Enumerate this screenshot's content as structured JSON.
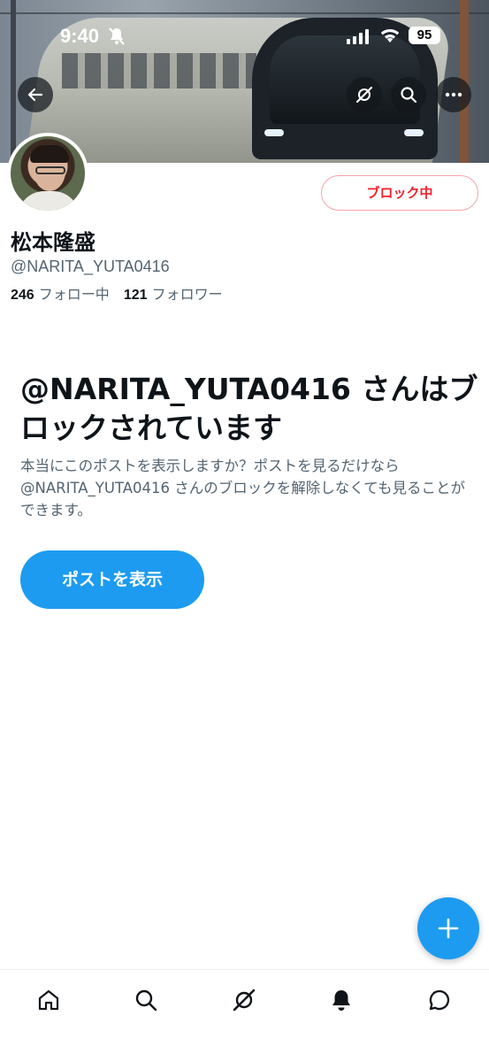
{
  "status_bar": {
    "time": "9:40",
    "battery": "95"
  },
  "profile": {
    "display_name": "松本隆盛",
    "handle": "@NARITA_YUTA0416",
    "following_count": "246",
    "following_label": "フォロー中",
    "followers_count": "121",
    "followers_label": "フォロワー",
    "block_button_label": "ブロック中"
  },
  "blocked_notice": {
    "title": "@NARITA_YUTA0416 さんはブロックされています",
    "description": "本当にこのポストを表示しますか？ポストを見るだけなら@NARITA_YUTA0416 さんのブロックを解除しなくても見ることができます。",
    "show_posts_label": "ポストを表示"
  },
  "icons": {
    "back": "arrow-left-icon",
    "grok": "grok-icon",
    "search": "search-icon",
    "more": "more-icon",
    "compose": "plus-icon",
    "tabs": [
      "home-icon",
      "search-icon",
      "grok-icon",
      "bell-icon",
      "messages-icon"
    ]
  },
  "colors": {
    "accent": "#1d9bf0",
    "block": "#f4212e",
    "secondary_text": "#536471"
  }
}
